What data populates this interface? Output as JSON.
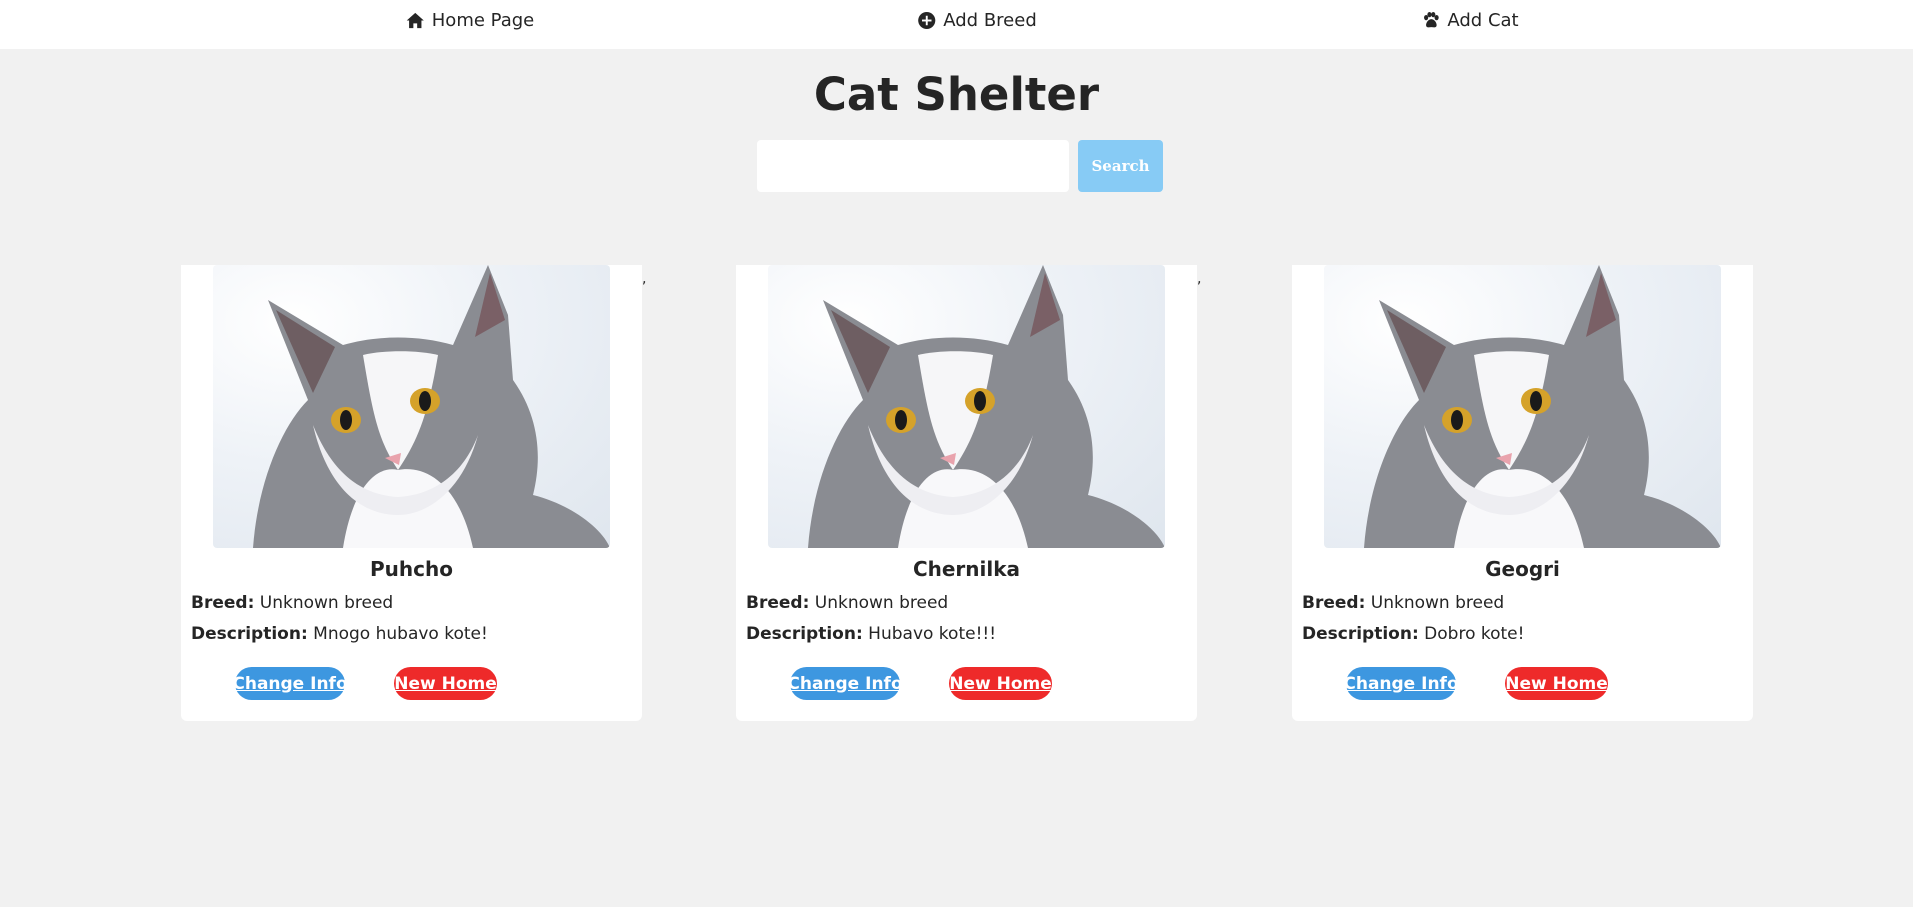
{
  "nav": {
    "items": [
      {
        "label": "Home Page",
        "icon": "home-icon"
      },
      {
        "label": "Add Breed",
        "icon": "plus-circle-icon"
      },
      {
        "label": "Add Cat",
        "icon": "paw-icon"
      }
    ]
  },
  "header": {
    "title": "Cat Shelter"
  },
  "search": {
    "value": "",
    "placeholder": "",
    "button_label": "Search"
  },
  "cats": [
    {
      "name": "Puhcho",
      "breed_label": "Breed:",
      "breed": "Unknown breed",
      "description_label": "Description:",
      "description": "Mnogo hubavo kote!",
      "change_label": "Change Info",
      "home_label": "New Home"
    },
    {
      "name": "Chernilka",
      "breed_label": "Breed:",
      "breed": "Unknown breed",
      "description_label": "Description:",
      "description": "Hubavo kote!!!",
      "change_label": "Change Info",
      "home_label": "New Home"
    },
    {
      "name": "Geogri",
      "breed_label": "Breed:",
      "breed": "Unknown breed",
      "description_label": "Description:",
      "description": "Dobro kote!",
      "change_label": "Change Info",
      "home_label": "New Home"
    }
  ],
  "colors": {
    "page_bg": "#f1f1f1",
    "card_bg": "#ffffff",
    "search_button": "#87cbf5",
    "change_button": "#3d97e0",
    "home_button": "#ee2a2a",
    "text": "#252525"
  }
}
